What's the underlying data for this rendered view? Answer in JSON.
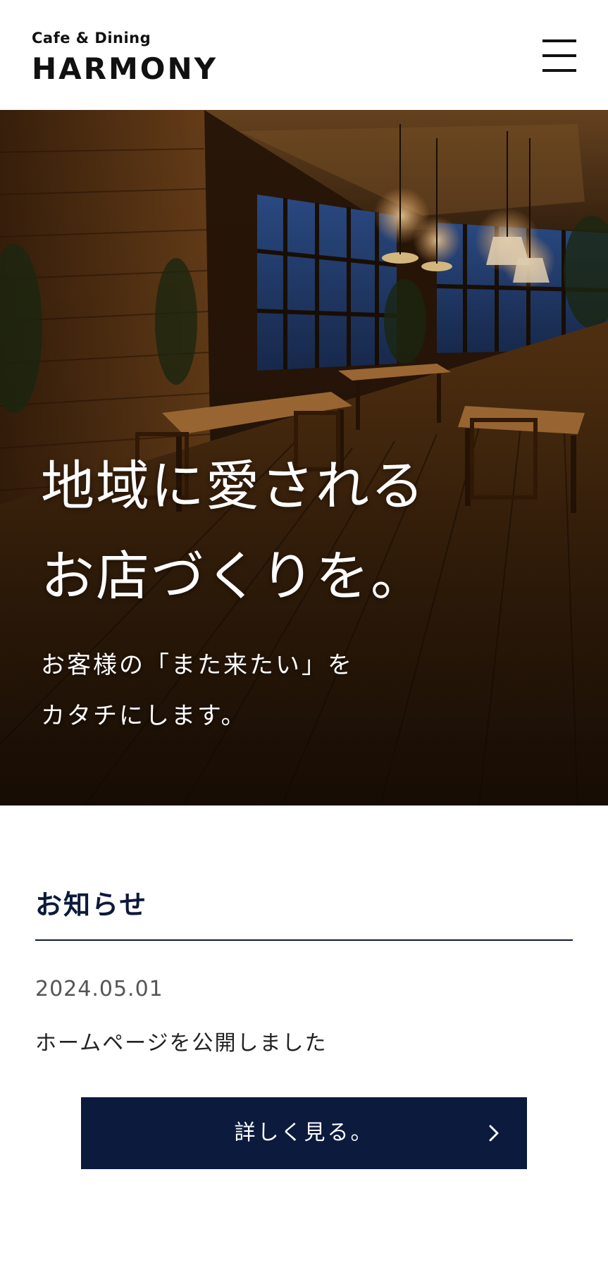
{
  "header": {
    "logo_sub": "Cafe & Dining",
    "logo_main": "HARMONY",
    "menu_icon": "hamburger-menu-icon"
  },
  "hero": {
    "title_line1": "地域に愛される",
    "title_line2": "お店づくりを。",
    "sub_line1": "お客様の「また来たい」を",
    "sub_line2": "カタチにします。"
  },
  "news": {
    "heading": "お知らせ",
    "items": [
      {
        "date": "2024.05.01",
        "title": "ホームページを公開しました"
      }
    ],
    "more_label": "詳しく見る。",
    "more_icon": "chevron-right-icon"
  },
  "colors": {
    "navy": "#0b1a3d",
    "heading_navy": "#0c1a3a",
    "text": "#222222",
    "date_gray": "#555555",
    "background": "#ffffff"
  }
}
